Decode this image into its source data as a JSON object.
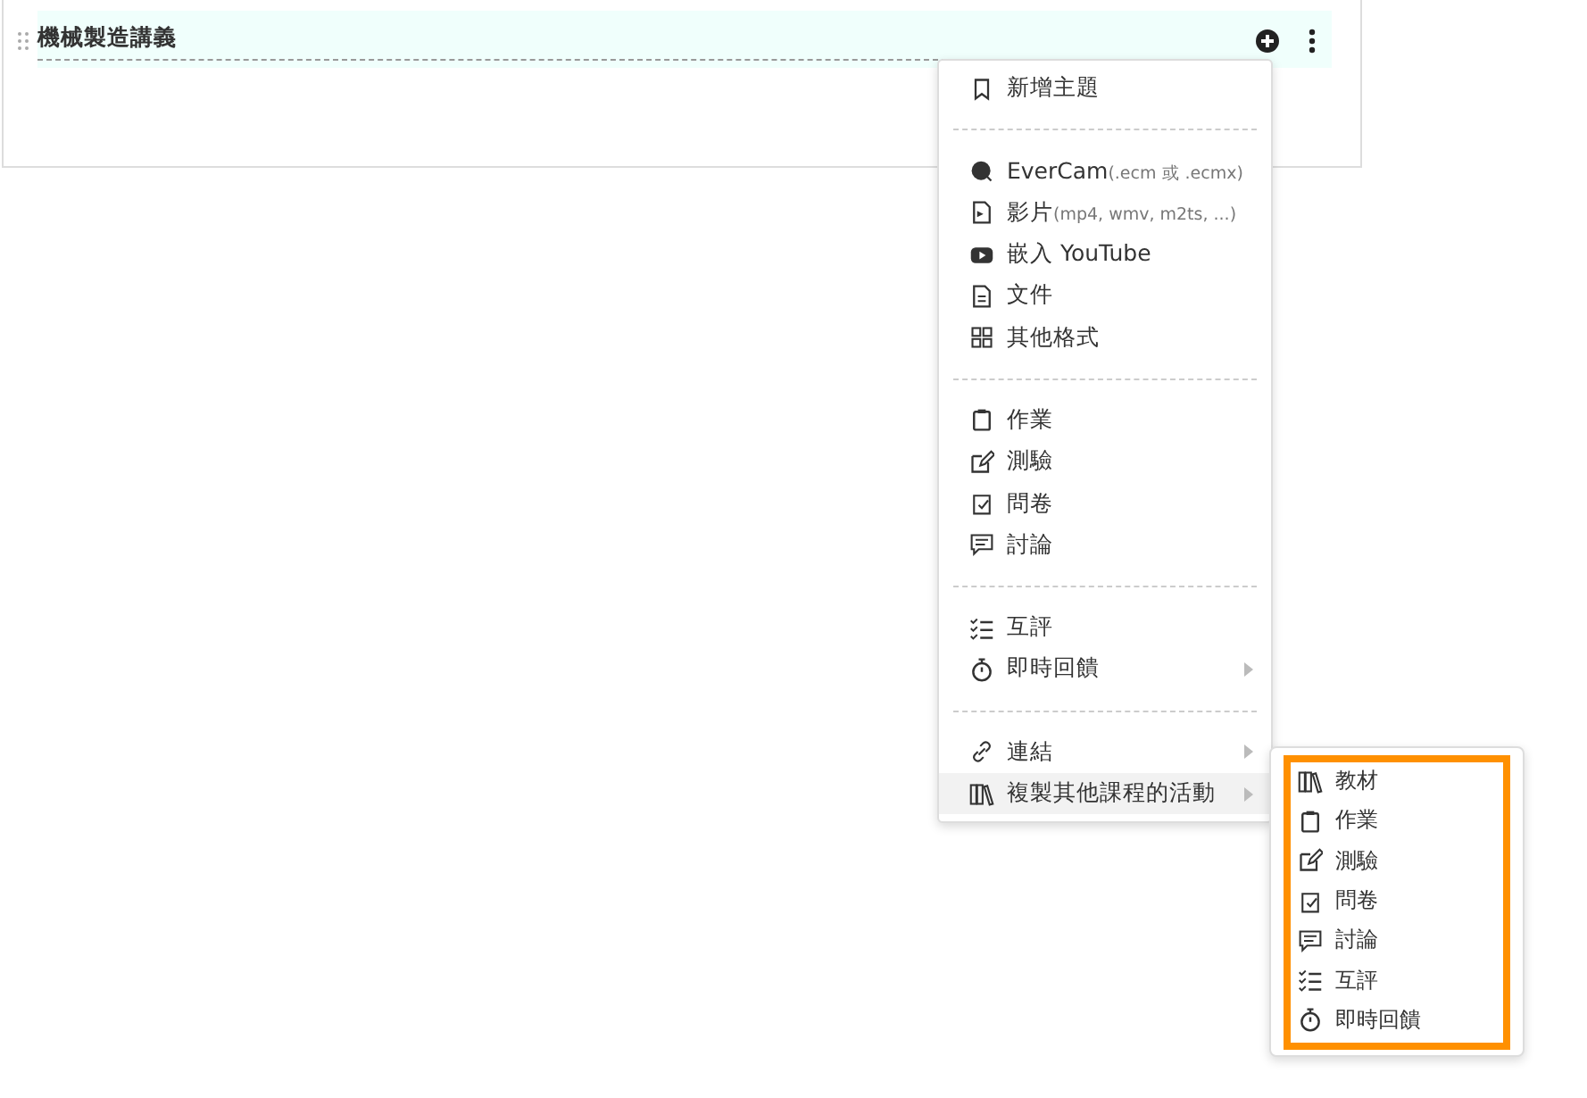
{
  "section": {
    "title": "機械製造講義"
  },
  "menu": {
    "groups": [
      [
        {
          "label": "新增主題",
          "has_submenu": false,
          "selected": false
        }
      ],
      [
        {
          "label": "EverCam",
          "hint": "(.ecm 或 .ecmx)",
          "has_submenu": false,
          "selected": false
        },
        {
          "label": "影片",
          "hint": "(mp4, wmv, m2ts, ...)",
          "has_submenu": false,
          "selected": false
        },
        {
          "label": "嵌入 YouTube",
          "has_submenu": false,
          "selected": false
        },
        {
          "label": "文件",
          "has_submenu": false,
          "selected": false
        },
        {
          "label": "其他格式",
          "has_submenu": false,
          "selected": false
        }
      ],
      [
        {
          "label": "作業",
          "has_submenu": false,
          "selected": false
        },
        {
          "label": "測驗",
          "has_submenu": false,
          "selected": false
        },
        {
          "label": "問卷",
          "has_submenu": false,
          "selected": false
        },
        {
          "label": "討論",
          "has_submenu": false,
          "selected": false
        }
      ],
      [
        {
          "label": "互評",
          "has_submenu": false,
          "selected": false
        },
        {
          "label": "即時回饋",
          "has_submenu": true,
          "selected": false
        }
      ],
      [
        {
          "label": "連結",
          "has_submenu": true,
          "selected": false
        },
        {
          "label": "複製其他課程的活動",
          "has_submenu": true,
          "selected": true
        }
      ]
    ]
  },
  "submenu": {
    "highlighted": true,
    "items": [
      {
        "label": "教材"
      },
      {
        "label": "作業"
      },
      {
        "label": "測驗"
      },
      {
        "label": "問卷"
      },
      {
        "label": "討論"
      },
      {
        "label": "互評"
      },
      {
        "label": "即時回饋"
      }
    ]
  }
}
